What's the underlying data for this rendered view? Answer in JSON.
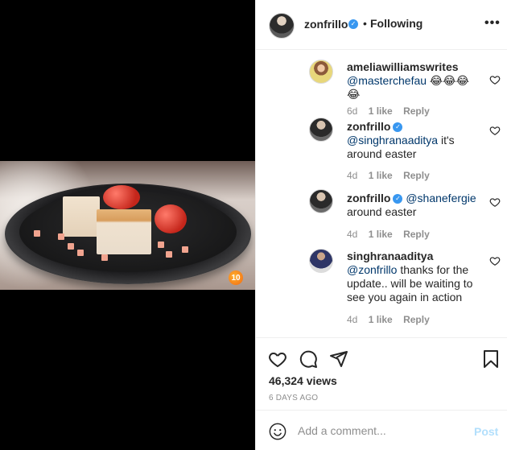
{
  "post_author": {
    "username": "zonfrillo",
    "follow_status": "Following",
    "separator": "•",
    "more_label": "•••"
  },
  "video": {
    "channel_badge": "10"
  },
  "comments": [
    {
      "username": "ameliawilliamswrites",
      "mention": "@masterchefau",
      "text": " 😂😂😂😂",
      "age": "6d",
      "likes": "1 like",
      "reply": "Reply",
      "verified": false
    },
    {
      "username": "zonfrillo",
      "mention": "@singhranaaditya",
      "text": " it's around easter",
      "age": "4d",
      "likes": "1 like",
      "reply": "Reply",
      "verified": true
    },
    {
      "username": "zonfrillo",
      "mention": "@shanefergie",
      "text": "around easter",
      "age": "4d",
      "likes": "1 like",
      "reply": "Reply",
      "verified": true
    },
    {
      "username": "singhranaaditya",
      "mention": "@zonfrillo",
      "text": " thanks for the update.. will be waiting to see you again in action",
      "age": "4d",
      "likes": "1 like",
      "reply": "Reply",
      "verified": false
    }
  ],
  "actions": {
    "icons": [
      "heart-icon",
      "comment-icon",
      "share-icon",
      "bookmark-icon"
    ],
    "views": "46,324 views",
    "date": "6 DAYS AGO"
  },
  "add_comment": {
    "placeholder": "Add a comment...",
    "post_label": "Post"
  },
  "colors": {
    "verified": "#3897f0",
    "mention": "#00376b",
    "muted": "#8e8e8e",
    "post_disabled": "#b2dffc"
  }
}
